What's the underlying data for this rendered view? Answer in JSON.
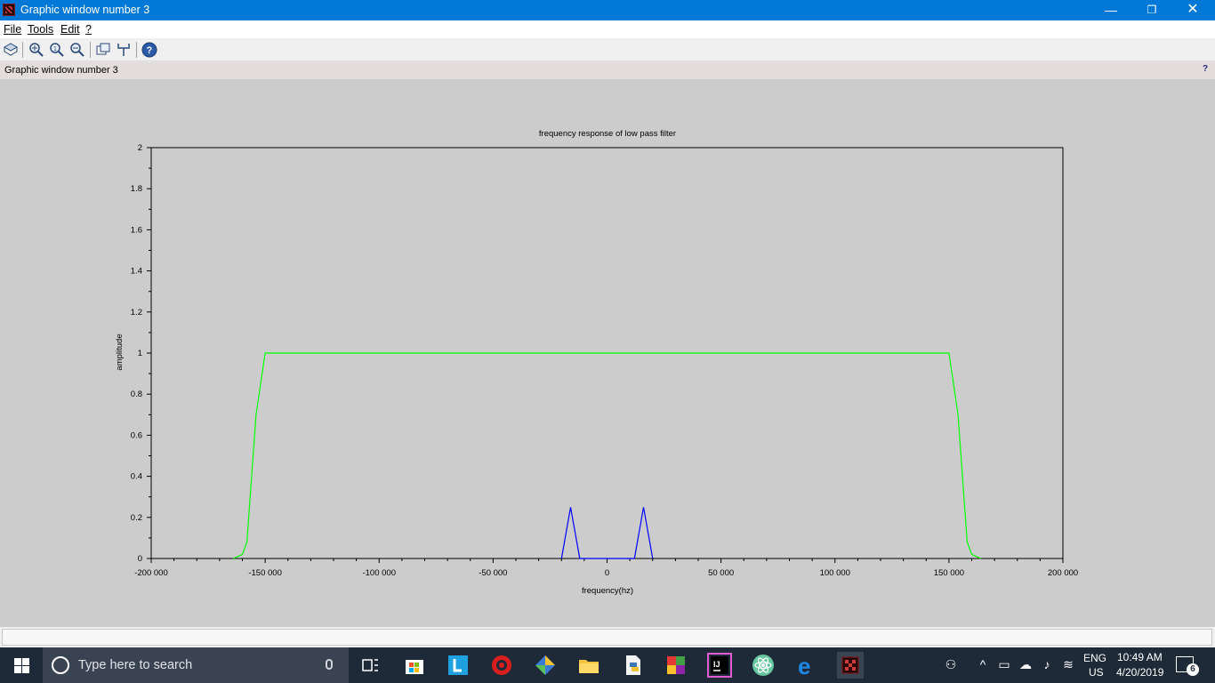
{
  "window": {
    "title": "Graphic window number 3",
    "minimize": "—",
    "maximize": "❐",
    "close": "✕"
  },
  "menu": {
    "file": "File",
    "tools": "Tools",
    "edit": "Edit",
    "help": "?"
  },
  "figure_header": {
    "title": "Graphic window number 3",
    "help": "?"
  },
  "colors": {
    "titlebar": "#0078d7",
    "filter_curve": "#00ff00",
    "signal_curve": "#0000ff",
    "canvas_bg": "#cccccc"
  },
  "chart_data": {
    "type": "line",
    "title": "frequency response of low pass filter",
    "xlabel": "frequency(hz)",
    "ylabel": "amplitude",
    "xlim": [
      -200000,
      200000
    ],
    "ylim": [
      0,
      2
    ],
    "x_tick_labels": [
      "-200 000",
      "-150 000",
      "-100 000",
      "-50 000",
      "0",
      "50 000",
      "100 000",
      "150 000",
      "200 000"
    ],
    "x_tick_values": [
      -200000,
      -150000,
      -100000,
      -50000,
      0,
      50000,
      100000,
      150000,
      200000
    ],
    "y_tick_labels": [
      "0",
      "0.2",
      "0.4",
      "0.6",
      "0.8",
      "1",
      "1.2",
      "1.4",
      "1.6",
      "1.8",
      "2"
    ],
    "y_tick_values": [
      0,
      0.2,
      0.4,
      0.6,
      0.8,
      1,
      1.2,
      1.4,
      1.6,
      1.8,
      2
    ],
    "grid": false,
    "series": [
      {
        "color": "#00ff00",
        "x": [
          -164000,
          -160000,
          -158000,
          -154000,
          -150000,
          150000,
          154000,
          158000,
          160000,
          164000
        ],
        "y": [
          0,
          0.02,
          0.08,
          0.7,
          1,
          1,
          0.7,
          0.08,
          0.02,
          0
        ]
      },
      {
        "color": "#0000ff",
        "x": [
          -20000,
          -16000,
          -12000,
          -10000,
          10000,
          12000,
          16000,
          20000
        ],
        "y": [
          0,
          0.25,
          0,
          0,
          0,
          0,
          0.25,
          0
        ]
      }
    ]
  },
  "taskbar": {
    "search_placeholder": "Type here to search",
    "lang_top": "ENG",
    "lang_bottom": "US",
    "time": "10:49 AM",
    "date": "4/20/2019",
    "notifications": "6"
  }
}
